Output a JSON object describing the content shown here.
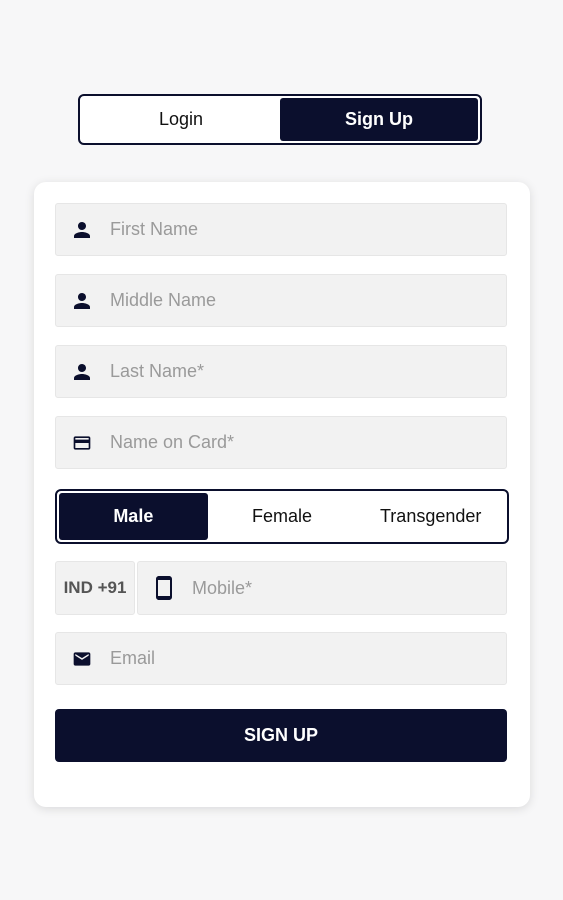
{
  "auth_tabs": {
    "login": "Login",
    "signup": "Sign Up",
    "active": "signup"
  },
  "form": {
    "first_name": {
      "placeholder": "First Name",
      "icon": "person-icon"
    },
    "middle_name": {
      "placeholder": "Middle Name",
      "icon": "person-icon"
    },
    "last_name": {
      "placeholder": "Last Name*",
      "icon": "person-icon"
    },
    "name_on_card": {
      "placeholder": "Name on Card*",
      "icon": "credit-card-icon"
    },
    "gender": {
      "options": [
        "Male",
        "Female",
        "Transgender"
      ],
      "selected": "Male"
    },
    "country_code": "IND +91",
    "mobile": {
      "placeholder": "Mobile*",
      "icon": "phone-icon"
    },
    "email": {
      "placeholder": "Email",
      "icon": "mail-icon"
    },
    "submit_label": "SIGN UP"
  },
  "colors": {
    "primary": "#0b0f2d",
    "field_bg": "#f2f2f2",
    "page_bg": "#f7f7f8"
  }
}
